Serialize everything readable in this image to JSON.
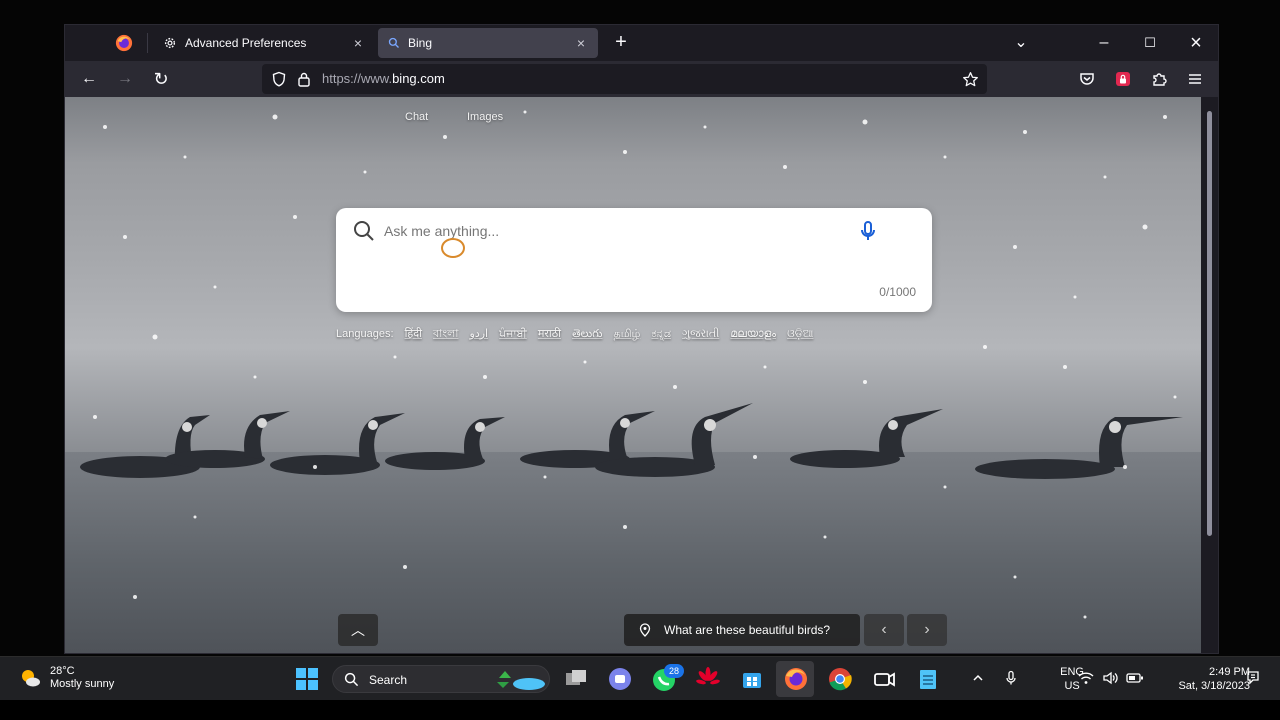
{
  "browser": {
    "tabs": [
      {
        "label": "Advanced Preferences",
        "close": "×"
      },
      {
        "label": "Bing",
        "close": "×"
      }
    ],
    "new_tab": "+",
    "window_controls": {
      "list": "⌄",
      "minimize": "–",
      "maximize": "☐",
      "close": "×"
    },
    "nav": {
      "back": "←",
      "forward": "→",
      "reload": "↻"
    },
    "url": {
      "scheme": "https://www.",
      "host": "bing.com"
    }
  },
  "bing": {
    "links": [
      "Chat",
      "Images"
    ],
    "search_placeholder": "Ask me anything...",
    "char_count": "0/1000",
    "languages_label": "Languages:",
    "languages": [
      "हिंदी",
      "বাংলা",
      "اردو",
      "ਪੰਜਾਬੀ",
      "मराठी",
      "తెలుగు",
      "தமிழ்",
      "ಕನ್ನಡ",
      "ગુજરાતી",
      "മലയാളം",
      "ଓଡ଼ିଆ"
    ],
    "caption": "What are these beautiful birds?",
    "up_arrow": "︿",
    "prev": "‹",
    "next": "›"
  },
  "taskbar": {
    "weather_temp": "28°C",
    "weather_desc": "Mostly sunny",
    "search_label": "Search",
    "whatsapp_badge": "28",
    "lang_top": "ENG",
    "lang_bottom": "US",
    "time": "2:49 PM",
    "date": "Sat, 3/18/2023"
  }
}
